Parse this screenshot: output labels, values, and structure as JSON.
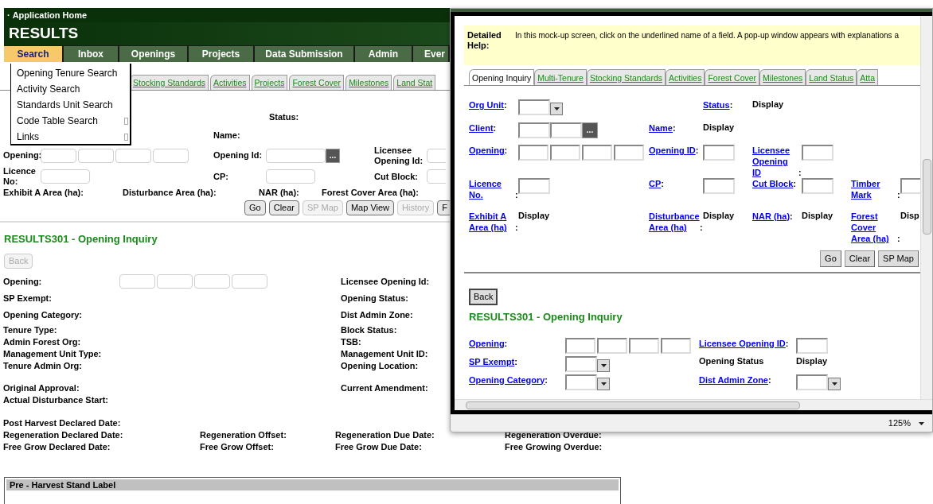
{
  "app": {
    "bullet": "·",
    "breadcrumb": "Application Home",
    "title": "RESULTS",
    "nav": [
      {
        "label": "Search",
        "selected": true
      },
      {
        "label": "Inbox",
        "selected": false
      },
      {
        "label": "Openings",
        "selected": false
      },
      {
        "label": "Projects",
        "selected": false
      },
      {
        "label": "Data Submission",
        "selected": false
      },
      {
        "label": "Admin",
        "selected": false
      },
      {
        "label": "Ever",
        "selected": false
      }
    ],
    "search_menu": [
      {
        "label": "Opening Tenure Search",
        "submenu": false
      },
      {
        "label": "Activity Search",
        "submenu": false
      },
      {
        "label": "Standards Unit Search",
        "submenu": false
      },
      {
        "label": "Code Table Search",
        "submenu": true
      },
      {
        "label": "Links",
        "submenu": true
      }
    ],
    "tabs": [
      "Stocking Standards",
      "Activities",
      "Projects",
      "Forest Cover",
      "Milestones",
      "Land Stat"
    ],
    "search_rows": [
      [
        {
          "label": "Status:"
        }
      ],
      [
        {
          "label": "Name:"
        }
      ],
      [
        {
          "label": "Opening:",
          "kind": "quad"
        },
        {
          "label": "Opening Id:",
          "kind": "input_lookup",
          "button": "..."
        },
        {
          "label": "Licensee Opening Id:",
          "kind": "input"
        }
      ],
      [
        {
          "label": "Licence No:",
          "kind": "input"
        },
        {
          "label": "CP:",
          "kind": "input"
        },
        {
          "label": "Cut Block:",
          "kind": "input"
        }
      ]
    ],
    "area_labels": [
      "Exhibit A Area (ha):",
      "Disturbance Area (ha):",
      "NAR (ha):",
      "Forest Cover Area (ha):"
    ],
    "search_buttons": [
      {
        "label": "Go",
        "disabled": false
      },
      {
        "label": "Clear",
        "disabled": false
      },
      {
        "label": "SP Map",
        "disabled": true
      },
      {
        "label": "Map View",
        "disabled": false
      },
      {
        "label": "History",
        "disabled": true
      },
      {
        "label": "F",
        "disabled": false
      }
    ],
    "inquiry": {
      "title": "RESULTS301 - Opening Inquiry",
      "back": {
        "label": "Back",
        "disabled": true
      },
      "groups": [
        [
          [
            {
              "label": "Opening:",
              "kind": "quad"
            },
            {
              "label": "Licensee Opening Id:"
            }
          ],
          [
            {
              "label": "SP Exempt:"
            },
            {
              "label": "Opening Status:"
            }
          ],
          [
            {
              "label": "Opening Category:"
            },
            {
              "label": "Dist Admin Zone:"
            }
          ]
        ],
        [
          [
            {
              "label": "Tenure Type:"
            },
            {
              "label": "Block Status:"
            }
          ],
          [
            {
              "label": "Admin Forest Org:"
            },
            {
              "label": "TSB:"
            }
          ],
          [
            {
              "label": "Management Unit Type:"
            },
            {
              "label": "Management Unit ID:"
            }
          ],
          [
            {
              "label": "Tenure Admin Org:"
            },
            {
              "label": "Opening Location:"
            }
          ]
        ],
        [
          [
            {
              "label": "Original Approval:"
            },
            {
              "label": "Current Amendment:"
            }
          ],
          [
            {
              "label": "Actual Disturbance Start:"
            }
          ]
        ]
      ],
      "dates": [
        [
          "Post Harvest Declared Date:"
        ],
        [
          "Regeneration Declared Date:",
          "Regeneration Offset:",
          "Regeneration Due Date:",
          "Regeneration Overdue:"
        ],
        [
          "Free Grow Declared Date:",
          "Free Grow Offset:",
          "Free Grow Due Date:",
          "Free Growing Overdue:"
        ]
      ]
    },
    "stand_label": {
      "title": "Pre - Harvest Stand Label"
    }
  },
  "popup": {
    "help_label": "Detailed Help:",
    "help_text": "In this mock-up screen, click on the underlined name of a field.  A pop-up window appears with explanations a",
    "tabs": [
      {
        "label": "Opening Inquiry",
        "selected": true
      },
      {
        "label": "Multi-Tenure",
        "selected": false
      },
      {
        "label": "Stocking Standards",
        "selected": false
      },
      {
        "label": "Activities",
        "selected": false
      },
      {
        "label": "Forest Cover",
        "selected": false
      },
      {
        "label": "Milestones",
        "selected": false
      },
      {
        "label": "Land Status",
        "selected": false
      },
      {
        "label": "Atta",
        "selected": false
      }
    ],
    "search_rows": [
      [
        {
          "label": "Org Unit",
          "link": true,
          "after": ":",
          "kind": "select"
        },
        {
          "label": "Status",
          "link": true,
          "after": ":",
          "kind": "display",
          "value": "Display"
        }
      ],
      [
        {
          "label": "Client",
          "link": true,
          "after": ":",
          "kind": "pair_lookup",
          "button": "..."
        },
        {
          "label": "Name",
          "link": true,
          "after": ":",
          "kind": "display",
          "value": "Display"
        }
      ],
      [
        {
          "label": "Opening",
          "link": true,
          "after": ":",
          "kind": "quad"
        },
        {
          "label": "Opening ID",
          "link": true,
          "after": ":",
          "kind": "input"
        },
        {
          "label": "Licensee Opening ID",
          "link": true,
          "after": ":",
          "kind": "input"
        }
      ],
      [
        {
          "label": "Licence No.",
          "link": true,
          "after": ":",
          "kind": "input"
        },
        {
          "label": "CP",
          "link": true,
          "after": ":",
          "kind": "input"
        },
        {
          "label": "Cut Block",
          "link": true,
          "after": ":",
          "kind": "input"
        },
        {
          "label": "Timber Mark",
          "link": true,
          "after": ":",
          "kind": "input"
        }
      ],
      [
        {
          "label": "Exhibit A Area (ha)",
          "link": true,
          "after": ":",
          "kind": "display",
          "value": "Display"
        },
        {
          "label": "Disturbance Area (ha)",
          "link": true,
          "after": ":",
          "kind": "display",
          "value": "Display"
        },
        {
          "label": "NAR (ha)",
          "link": true,
          "after": ":",
          "kind": "display",
          "value": "Display"
        },
        {
          "label": "Forest Cover Area (ha)",
          "link": true,
          "after": ":",
          "kind": "display",
          "value": "Disp"
        }
      ]
    ],
    "buttons": [
      "Go",
      "Clear",
      "SP Map"
    ],
    "back": "Back",
    "title": "RESULTS301 - Opening Inquiry",
    "inquiry_rows": [
      [
        {
          "label": "Opening",
          "link": true,
          "after": ":",
          "kind": "quad"
        },
        {
          "label": "Licensee Opening ID",
          "link": true,
          "after": ":",
          "kind": "input"
        }
      ],
      [
        {
          "label": "SP Exempt",
          "link": true,
          "after": ":",
          "kind": "select"
        },
        {
          "label": "Opening Status",
          "link": false,
          "kind": "display",
          "value": "Display"
        }
      ],
      [
        {
          "label": "Opening Category",
          "link": true,
          "after": ":",
          "kind": "select"
        },
        {
          "label": "Dist Admin Zone",
          "link": true,
          "after": ":",
          "kind": "select"
        }
      ]
    ],
    "zoom": "125%"
  }
}
